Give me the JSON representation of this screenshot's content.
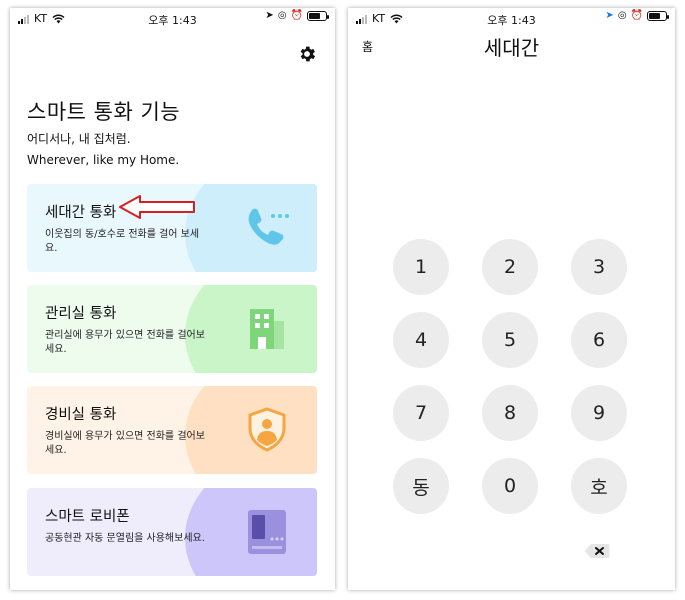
{
  "status_bar": {
    "carrier": "KT",
    "time": "오후 1:43"
  },
  "left_screen": {
    "title": "스마트 통화 기능",
    "subtitle_ko": "어디서나, 내 집처럼.",
    "subtitle_en": "Wherever, like my Home.",
    "cards": [
      {
        "title": "세대간 통화",
        "desc": "이웃집의 동/호수로 전화를 걸어 보세요.",
        "icon": "phone-icon",
        "accent": "#5fc6ea"
      },
      {
        "title": "관리실 통화",
        "desc": "관리실에 용무가 있으면 전화를 걸어보세요.",
        "icon": "building-icon",
        "accent": "#6fcf6a"
      },
      {
        "title": "경비실 통화",
        "desc": "경비실에 용무가 있으면 전화를 걸어보세요.",
        "icon": "security-shield-icon",
        "accent": "#f4a640"
      },
      {
        "title": "스마트 로비폰",
        "desc": "공동현관 자동 문열림을 사용해보세요.",
        "icon": "lobby-phone-icon",
        "accent": "#8f84d8"
      }
    ],
    "annotation_color": "#d62020"
  },
  "right_screen": {
    "home_label": "홈",
    "title": "세대간",
    "keys": [
      "1",
      "2",
      "3",
      "4",
      "5",
      "6",
      "7",
      "8",
      "9",
      "동",
      "0",
      "호"
    ],
    "backspace_icon": "backspace-icon"
  }
}
